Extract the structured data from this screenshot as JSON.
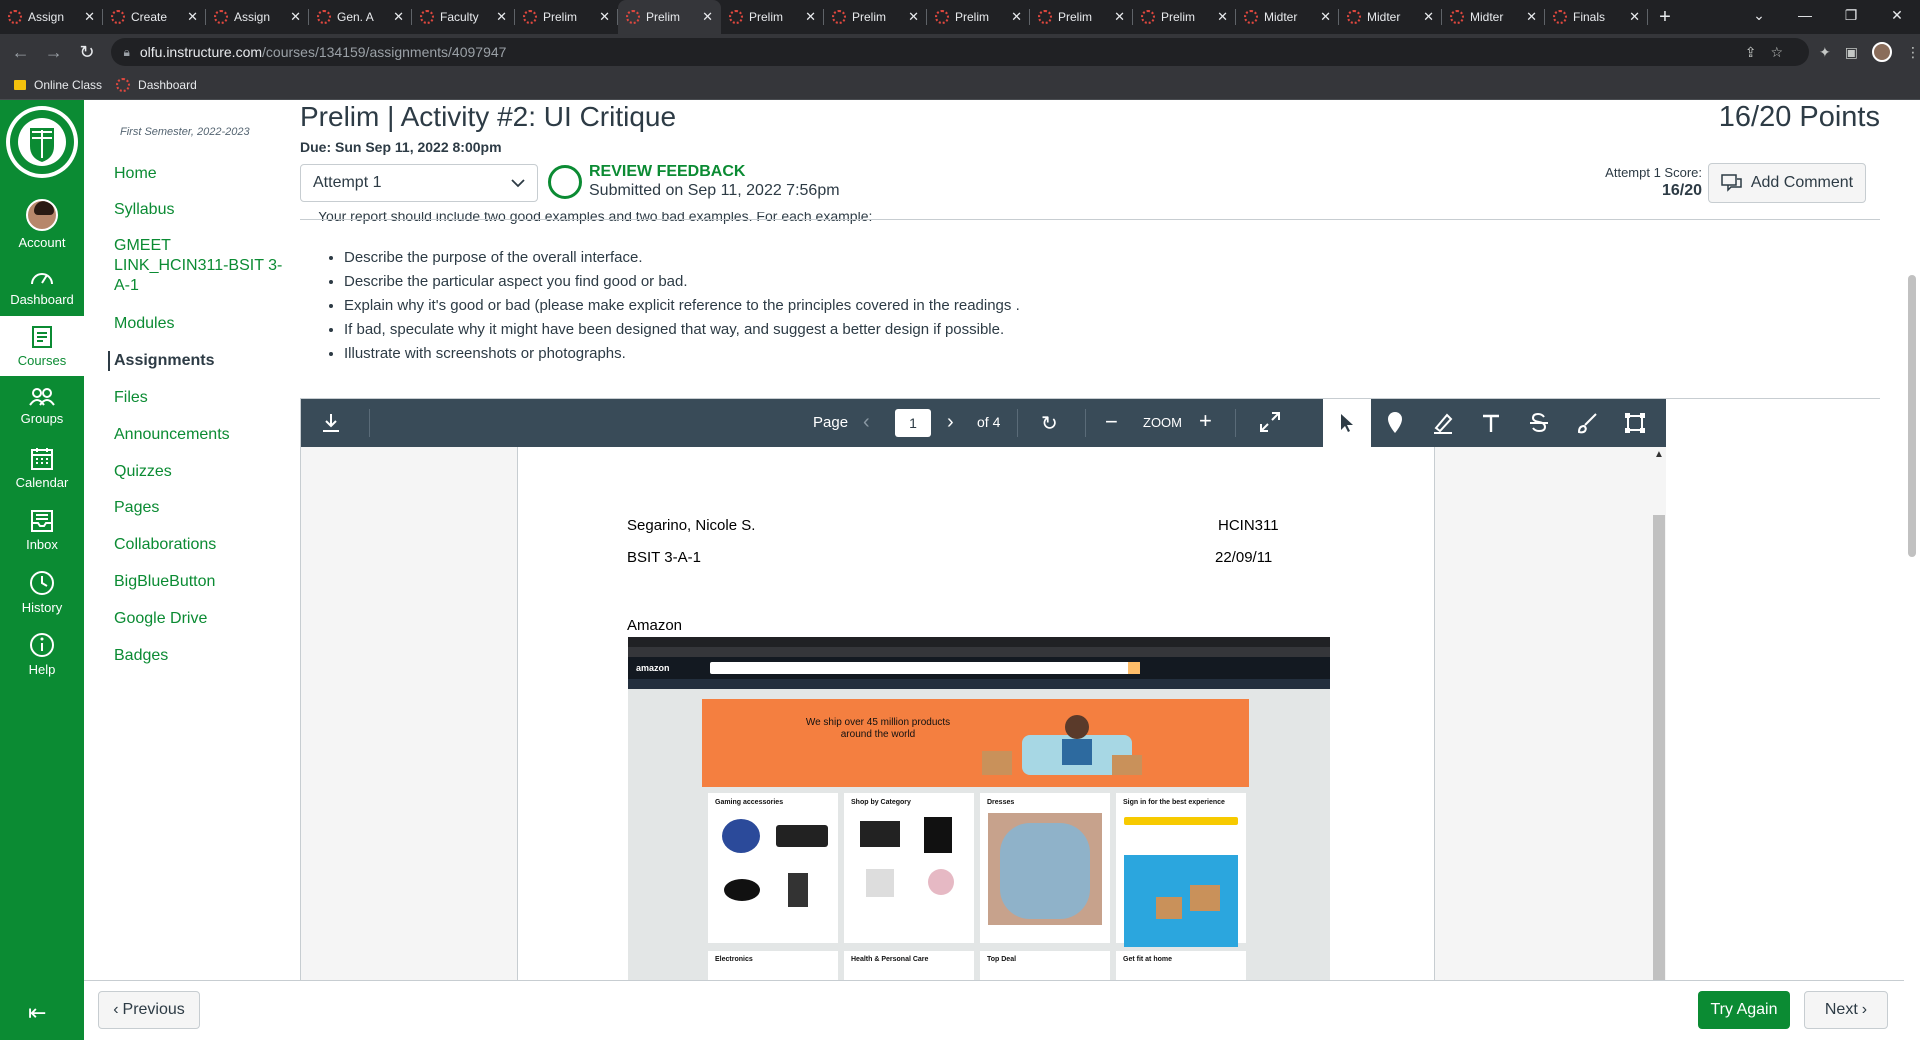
{
  "browser": {
    "tabs": [
      {
        "label": "Assign"
      },
      {
        "label": "Create"
      },
      {
        "label": "Assign"
      },
      {
        "label": "Gen. A"
      },
      {
        "label": "Faculty"
      },
      {
        "label": "Prelim"
      },
      {
        "label": "Prelim",
        "active": true
      },
      {
        "label": "Prelim"
      },
      {
        "label": "Prelim"
      },
      {
        "label": "Prelim"
      },
      {
        "label": "Prelim"
      },
      {
        "label": "Prelim"
      },
      {
        "label": "Midter"
      },
      {
        "label": "Midter"
      },
      {
        "label": "Midter"
      },
      {
        "label": "Finals"
      }
    ],
    "url_host": "olfu.instructure.com",
    "url_path": "/courses/134159/assignments/4097947",
    "bookmarks": [
      "Online Class",
      "Dashboard"
    ]
  },
  "global_nav": {
    "items": [
      {
        "label": "Account",
        "icon": "avatar"
      },
      {
        "label": "Dashboard",
        "icon": "dashboard-icon"
      },
      {
        "label": "Courses",
        "icon": "courses-icon"
      },
      {
        "label": "Groups",
        "icon": "groups-icon"
      },
      {
        "label": "Calendar",
        "icon": "calendar-icon"
      },
      {
        "label": "Inbox",
        "icon": "inbox-icon"
      },
      {
        "label": "History",
        "icon": "history-icon"
      },
      {
        "label": "Help",
        "icon": "help-icon"
      }
    ],
    "brand_color": "#0b8b33"
  },
  "course_nav": {
    "term": "First Semester, 2022-2023",
    "items": [
      "Home",
      "Syllabus",
      "GMEET LINK_HCIN311-BSIT 3-A-1",
      "Modules",
      "Assignments",
      "Files",
      "Announcements",
      "Quizzes",
      "Pages",
      "Collaborations",
      "BigBlueButton",
      "Google Drive",
      "Badges"
    ],
    "active": "Assignments"
  },
  "assignment": {
    "title": "Prelim | Activity #2: UI Critique",
    "due": "Due: Sun Sep 11, 2022 8:00pm",
    "points_score": "16/20",
    "points_label": "Points",
    "attempt": "Attempt 1",
    "feedback_title": "REVIEW FEEDBACK",
    "feedback_sub": "Submitted on Sep 11, 2022 7:56pm",
    "attempt_score_label": "Attempt 1 Score:",
    "attempt_score": "16/20",
    "add_comment": "Add Comment",
    "cut_line": "Your report should include two good examples and two bad examples. For each example:",
    "bullets": [
      "Describe the purpose of the overall interface.",
      "Describe the particular aspect you find good or bad.",
      "Explain why it's good or bad (please make explicit reference to the principles covered in the readings .",
      "If bad, speculate why it might have been designed that way, and suggest a better design if possible.",
      "Illustrate with screenshots or photographs."
    ]
  },
  "viewer": {
    "page_label": "Page",
    "page_current": "1",
    "page_total": "of 4",
    "zoom_label": "ZOOM",
    "doc": {
      "name": "Segarino, Nicole S.",
      "course_code": "HCIN311",
      "section": "BSIT 3-A-1",
      "date": "22/09/11",
      "heading": "Amazon",
      "amazon": {
        "logo": "amazon",
        "hero": "We ship over 45 million products around the world",
        "cards": [
          "Gaming accessories",
          "Shop by Category",
          "Dresses",
          "Sign in for the best experience"
        ],
        "cards_row2": [
          "Electronics",
          "Health & Personal Care",
          "Top Deal",
          "Get fit at home"
        ]
      }
    }
  },
  "footer": {
    "previous": "Previous",
    "try_again": "Try Again",
    "next": "Next"
  }
}
